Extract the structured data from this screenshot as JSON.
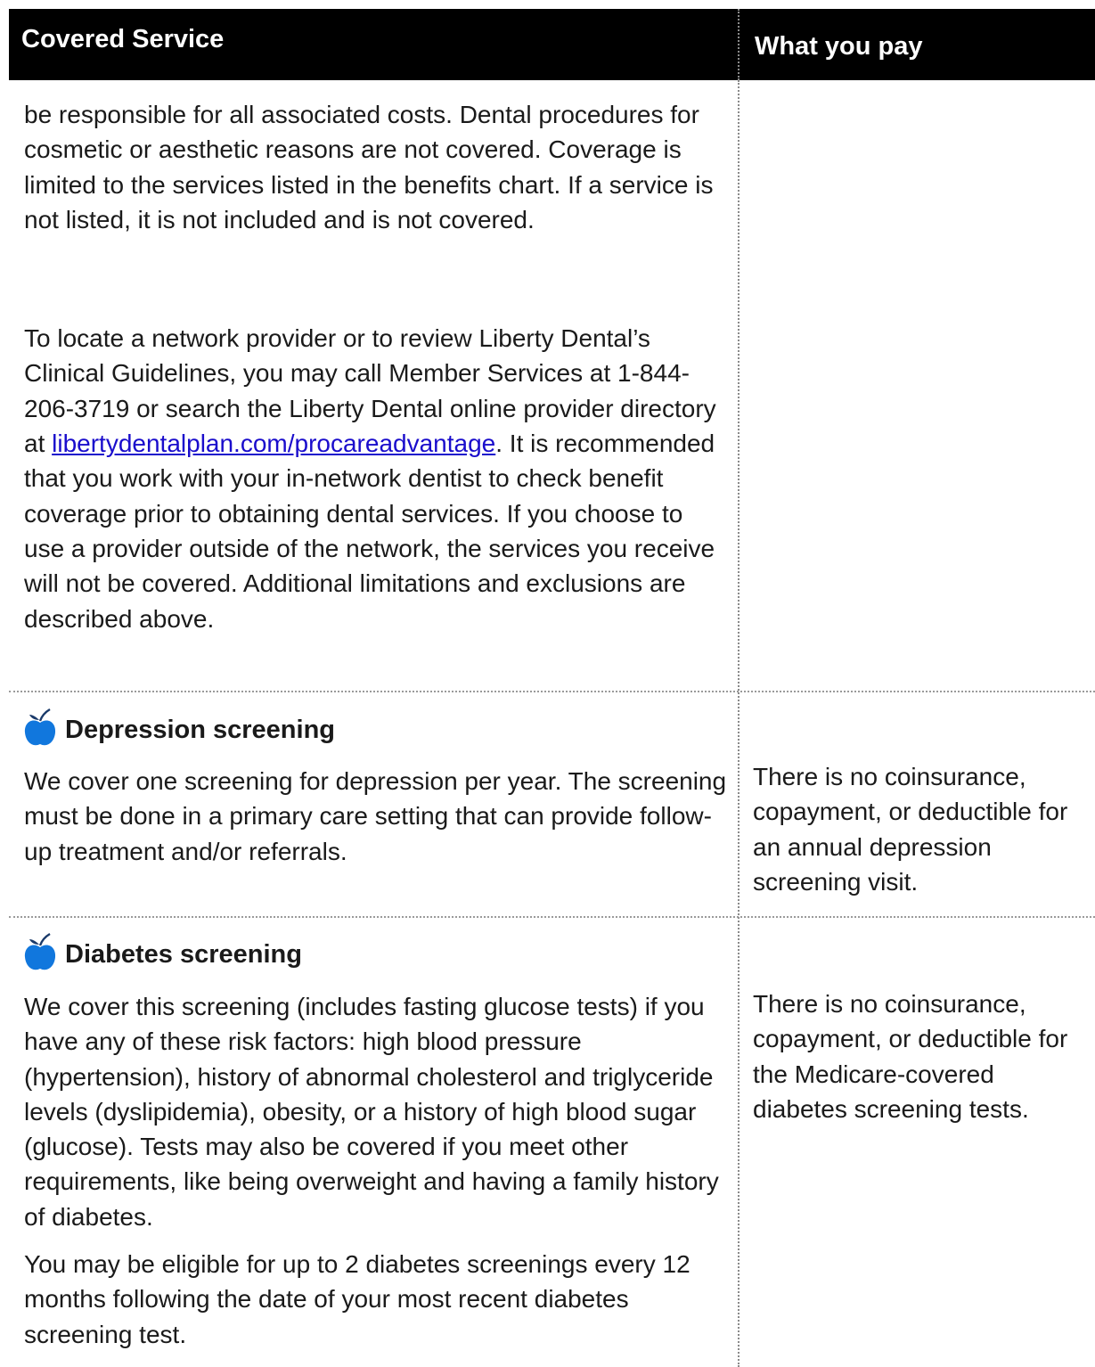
{
  "header": {
    "covered_service": "Covered Service",
    "what_you_pay": "What you pay"
  },
  "dental": {
    "para1": "be responsible for all associated costs. Dental procedures for cosmetic or aesthetic reasons are not covered. Coverage is limited to the services listed in the benefits chart. If a service is not listed, it is not included and is not covered.",
    "para2_before": "To locate a network provider or to review Liberty Dental’s Clinical Guidelines, you may call Member Services at 1-844-206-3719 or search the Liberty Dental online provider directory at ",
    "para2_link": "libertydentalplan.com/procareadvantage",
    "para2_after": ". It is recommended that you work with your in-network dentist to check benefit coverage prior to obtaining dental services. If you choose to use a provider outside of the network, the services you receive will not be covered. Additional limitations and exclusions are described above."
  },
  "depression": {
    "icon": "apple-icon",
    "title": "Depression screening",
    "description": "We cover one screening for depression per year. The screening must be done in a primary care setting that can provide follow-up treatment and/or referrals.",
    "cost": "There is no coinsurance, copayment, or deductible for an annual depression screening visit."
  },
  "diabetes": {
    "icon": "apple-icon",
    "title": "Diabetes screening",
    "description": "We cover this screening (includes fasting glucose tests) if you have any of these risk factors: high blood pressure (hypertension), history of abnormal cholesterol and triglyceride levels (dyslipidemia), obesity, or a history of high blood sugar (glucose). Tests may also be covered if you meet other requirements, like being overweight and having a family history of diabetes.",
    "eligibility": "You may be eligible for up to 2 diabetes screenings every 12 months following the date of your most recent diabetes screening test.",
    "cost": "There is no coinsurance, copayment, or deductible for the Medicare-covered diabetes screening tests."
  },
  "colors": {
    "header_bg": "#000000",
    "icon_blue": "#1177dd",
    "link_blue": "#1a0dcc"
  }
}
